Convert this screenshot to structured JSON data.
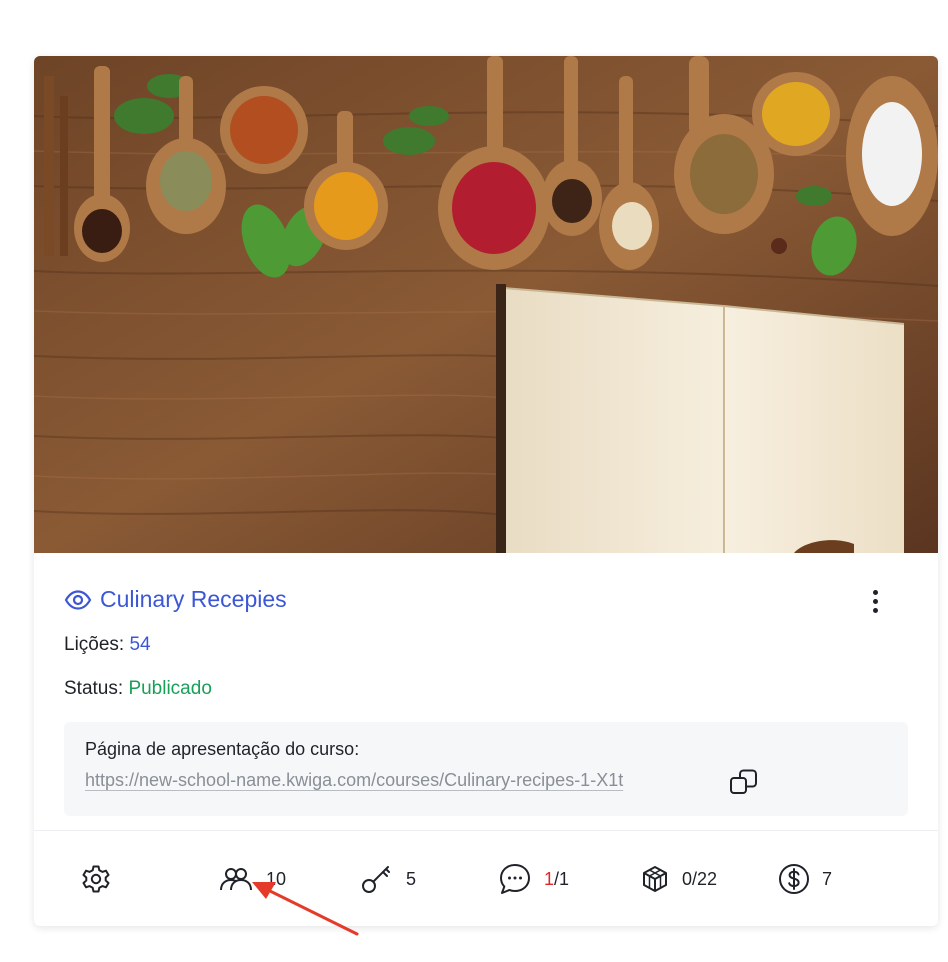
{
  "course": {
    "title": "Culinary Recepies",
    "lessons_label": "Lições:",
    "lessons_count": "54",
    "status_label": "Status:",
    "status_value": "Publicado"
  },
  "landing": {
    "label": "Página de apresentação do curso:",
    "url": "https://new-school-name.kwiga.com/courses/Culinary-recipes-1-X1t"
  },
  "stats": {
    "students": "10",
    "keys": "5",
    "comments_unread": "1",
    "comments_sep": "/",
    "comments_total": "1",
    "cubes": "0/22",
    "offers": "7"
  },
  "icons": [
    "eye-icon",
    "more-vertical-icon",
    "copy-icon",
    "gear-icon",
    "users-icon",
    "key-icon",
    "comment-icon",
    "cube-icon",
    "dollar-icon"
  ],
  "colors": {
    "accent": "#3b57d6",
    "published": "#19a058",
    "unread": "#e0262b",
    "annotation_arrow": "#e53a2a"
  }
}
